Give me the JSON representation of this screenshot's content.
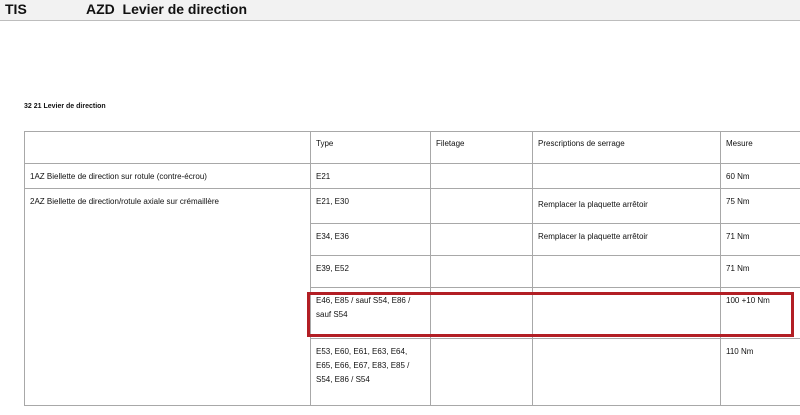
{
  "header": {
    "app": "TIS",
    "title": "AZD  Levier de direction"
  },
  "section": {
    "heading": "32 21 Levier de direction"
  },
  "table": {
    "columns": [
      "Type",
      "Filetage",
      "Prescriptions de serrage",
      "Mesure"
    ],
    "rows": [
      {
        "description": "1AZ  Biellette de direction sur rotule (contre-écrou)",
        "type": "E21",
        "filetage": "",
        "serrage": "",
        "mesure": "60 Nm"
      },
      {
        "description": "2AZ  Biellette de direction/rotule axiale sur crémaillère",
        "type": "E21, E30",
        "filetage": "",
        "serrage": "Remplacer la plaquette arrêtoir",
        "mesure": "75 Nm"
      },
      {
        "type": "E34, E36",
        "filetage": "",
        "serrage": "Remplacer la plaquette arrêtoir",
        "mesure": "71 Nm"
      },
      {
        "type": "E39, E52",
        "filetage": "",
        "serrage": "",
        "mesure": "71 Nm"
      },
      {
        "type": "E46, E85 / sauf S54, E86 / sauf S54",
        "filetage": "",
        "serrage": "",
        "mesure": "100 +10 Nm",
        "highlighted": true
      },
      {
        "type": "E53, E60, E61, E63, E64, E65, E66, E67, E83, E85 / S54, E86 / S54",
        "filetage": "",
        "serrage": "",
        "mesure": "110 Nm"
      }
    ]
  },
  "colors": {
    "highlight_border": "#b21e24",
    "table_border": "#a8a8a8",
    "header_bar": "#f2f2f2"
  }
}
